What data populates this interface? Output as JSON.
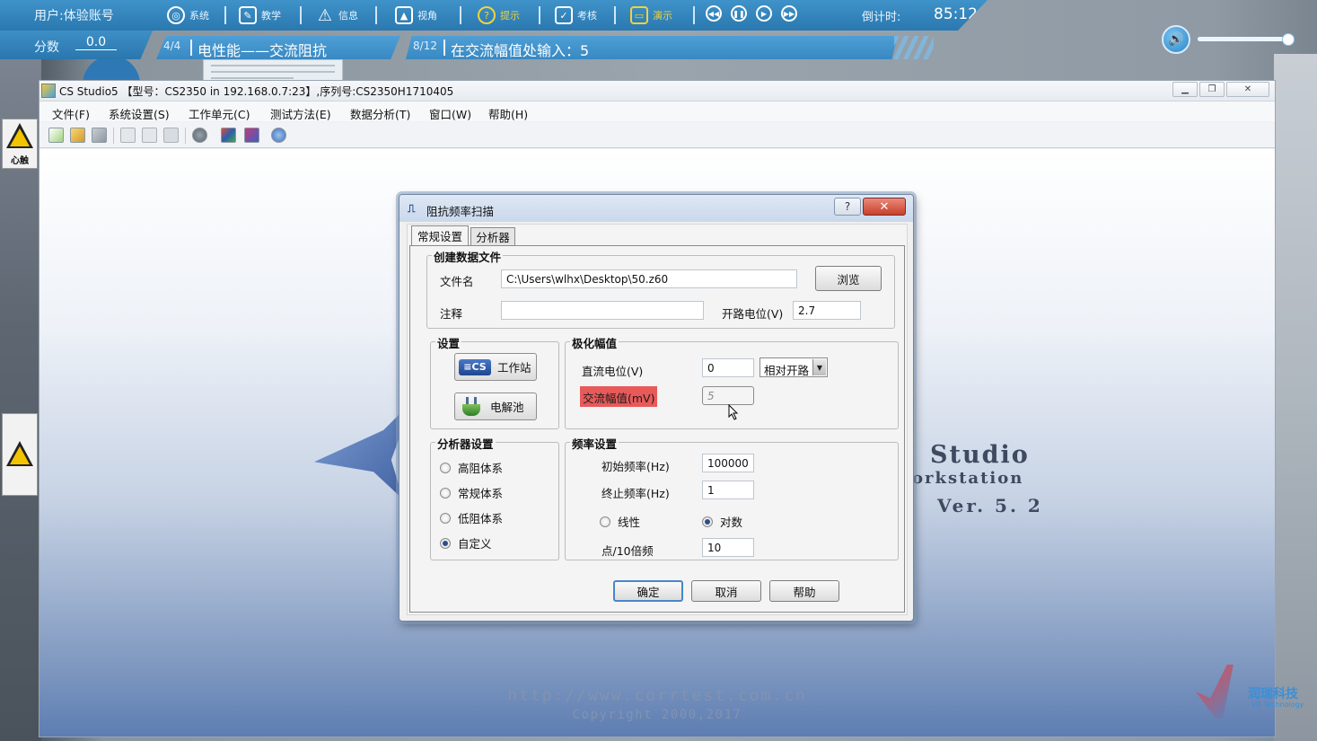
{
  "hud": {
    "user": "用户:体验账号",
    "menu": [
      {
        "label": "系统",
        "icon": "globe-icon"
      },
      {
        "label": "教学",
        "icon": "teach-icon"
      },
      {
        "label": "信息",
        "icon": "warning-icon"
      },
      {
        "label": "视角",
        "icon": "image-icon"
      },
      {
        "label": "提示",
        "icon": "help-icon"
      },
      {
        "label": "考核",
        "icon": "clipboard-icon"
      },
      {
        "label": "演示",
        "icon": "monitor-icon"
      }
    ],
    "countdown_label": "倒计时:",
    "countdown_value": "85:12",
    "score_label": "分数",
    "score_value": "0.0",
    "step_count": "4/4",
    "step_title": "电性能——交流阻抗",
    "task_count": "8/12",
    "task_text": "在交流幅值处输入：5",
    "volume": 0.95
  },
  "scene": {
    "sign_label": "心触"
  },
  "app": {
    "title": "CS Studio5  【型号：CS2350 in 192.168.0.7:23】,序列号:CS2350H1710405",
    "menu": [
      "文件(F)",
      "系统设置(S)",
      "工作单元(C)",
      "测试方法(E)",
      "数据分析(T)",
      "窗口(W)",
      "帮助(H)"
    ],
    "toolbar_icons": [
      "new-icon",
      "open-icon",
      "save-icon",
      "copy-icon",
      "paste-icon",
      "print-icon",
      "stop-icon",
      "chart-icon",
      "analyze-icon",
      "network-icon"
    ],
    "brand_line1": "Studio",
    "brand_line2": "orkstation",
    "brand_line3": "Ver. 5. 2",
    "url": "http://www.corrtest.com.cn",
    "copyright": "Copyright 2000,2017",
    "vr_logo_text": "润瑞科技",
    "vr_logo_sub": "VR Technology"
  },
  "dialog": {
    "title": "阻抗频率扫描",
    "tabs": [
      "常规设置",
      "分析器"
    ],
    "create_file": {
      "group_title": "创建数据文件",
      "filename_label": "文件名",
      "filename_value": "C:\\Users\\wlhx\\Desktop\\50.z60",
      "browse_button": "浏览",
      "note_label": "注释",
      "note_value": "",
      "ocp_label": "开路电位(V)",
      "ocp_value": "2.7"
    },
    "settings": {
      "group_title": "设置",
      "workstation_button": "工作站",
      "workstation_badge": "≡CS",
      "cell_button": "电解池"
    },
    "polarization": {
      "group_title": "极化幅值",
      "dc_label": "直流电位(V)",
      "dc_value": "0",
      "dc_ref": "相对开路",
      "ac_label": "交流幅值(mV)",
      "ac_value": "5"
    },
    "analyzer": {
      "group_title": "分析器设置",
      "options": [
        "高阻体系",
        "常规体系",
        "低阻体系",
        "自定义"
      ],
      "selected": 3
    },
    "frequency": {
      "group_title": "频率设置",
      "start_label": "初始频率(Hz)",
      "start_value": "100000",
      "end_label": "终止频率(Hz)",
      "end_value": "1",
      "linear_label": "线性",
      "log_label": "对数",
      "scale_selected": "log",
      "points_label": "点/10倍频",
      "points_value": "10"
    },
    "buttons": {
      "ok": "确定",
      "cancel": "取消",
      "help": "帮助"
    }
  }
}
